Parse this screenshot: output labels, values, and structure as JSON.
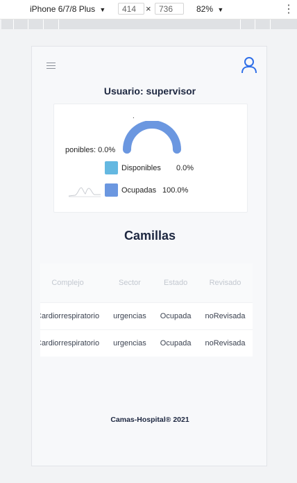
{
  "devtools": {
    "device": "iPhone 6/7/8 Plus",
    "width": "414",
    "height": "736",
    "times": "×",
    "zoom": "82%",
    "more": "⋮",
    "caret": "▼"
  },
  "header": {
    "menu_icon": "hamburger-menu-icon",
    "user_icon": "user-account-icon",
    "user_title": "Usuario: supervisor"
  },
  "chart_data": {
    "type": "pie",
    "title": "",
    "tooltip_dot": ".",
    "clipped_label": "ponibles: 0.0%",
    "slices": [
      {
        "name": "Disponibles",
        "value": 0.0,
        "value_label": "0.0%",
        "color": "#64b8e1"
      },
      {
        "name": "Ocupadas",
        "value": 100.0,
        "value_label": "100.0%",
        "color": "#6b97e0"
      }
    ]
  },
  "main": {
    "section_title": "Camillas",
    "table": {
      "columns": [
        "Complejo",
        "Sector",
        "Estado",
        "Revisado"
      ],
      "rows": [
        [
          "Cardiorrespiratorio",
          "urgencias",
          "Ocupada",
          "noRevisada"
        ],
        [
          "Cardiorrespiratorio",
          "urgencias",
          "Ocupada",
          "noRevisada"
        ]
      ]
    }
  },
  "footer": {
    "text": "Camas-Hospital® 2021"
  }
}
